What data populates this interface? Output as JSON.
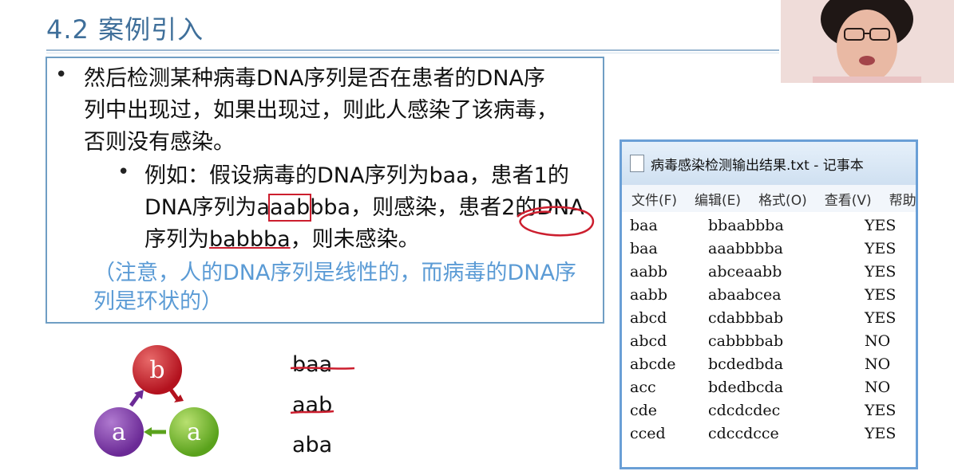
{
  "slide": {
    "title": "4.2 案例引入"
  },
  "content": {
    "bullet1": "然后检测某种病毒DNA序列是否在患者的DNA序列中出现过，如果出现过，则此人感染了该病毒，否则没有感染。",
    "bullet2_prefix": "例如：假设病毒的DNA序列为baa，患者1的DNA序列为",
    "bullet2_seq1_a": "a",
    "bullet2_seq1_b": "aab",
    "bullet2_seq1_c": "bba",
    "bullet2_mid": "，则感染，患者2的DNA序列为",
    "bullet2_seq2": "babbba",
    "bullet2_suffix": "，则未感染。",
    "note": "（注意，人的DNA序列是线性的，而病毒的DNA序列是环状的）"
  },
  "notepad": {
    "title": "病毒感染检测输出结果.txt - 记事本",
    "menu": [
      "文件(F)",
      "编辑(E)",
      "格式(O)",
      "查看(V)",
      "帮助"
    ],
    "rows": [
      [
        "baa",
        "bbaabbba",
        "YES"
      ],
      [
        "baa",
        "aaabbbba",
        "YES"
      ],
      [
        "aabb",
        "abceaabb",
        "YES"
      ],
      [
        "aabb",
        "abaabcea",
        "YES"
      ],
      [
        "abcd",
        "cdabbbab",
        "YES"
      ],
      [
        "abcd",
        "cabbbbab",
        "NO"
      ],
      [
        "abcde",
        "bcdedbda",
        "NO"
      ],
      [
        "acc",
        "bdedbcda",
        "NO"
      ],
      [
        "cde",
        "cdcdcdec",
        "YES"
      ],
      [
        "cced",
        "cdccdcce",
        "YES"
      ]
    ]
  },
  "diagram": {
    "top": "b",
    "left": "a",
    "right": "a",
    "sequences": [
      "baa",
      "aab",
      "aba"
    ]
  },
  "colors": {
    "title": "#3f6f9a",
    "box_border": "#6f9ec4",
    "note": "#5b9bd5",
    "annotation": "#cc1e2e"
  }
}
